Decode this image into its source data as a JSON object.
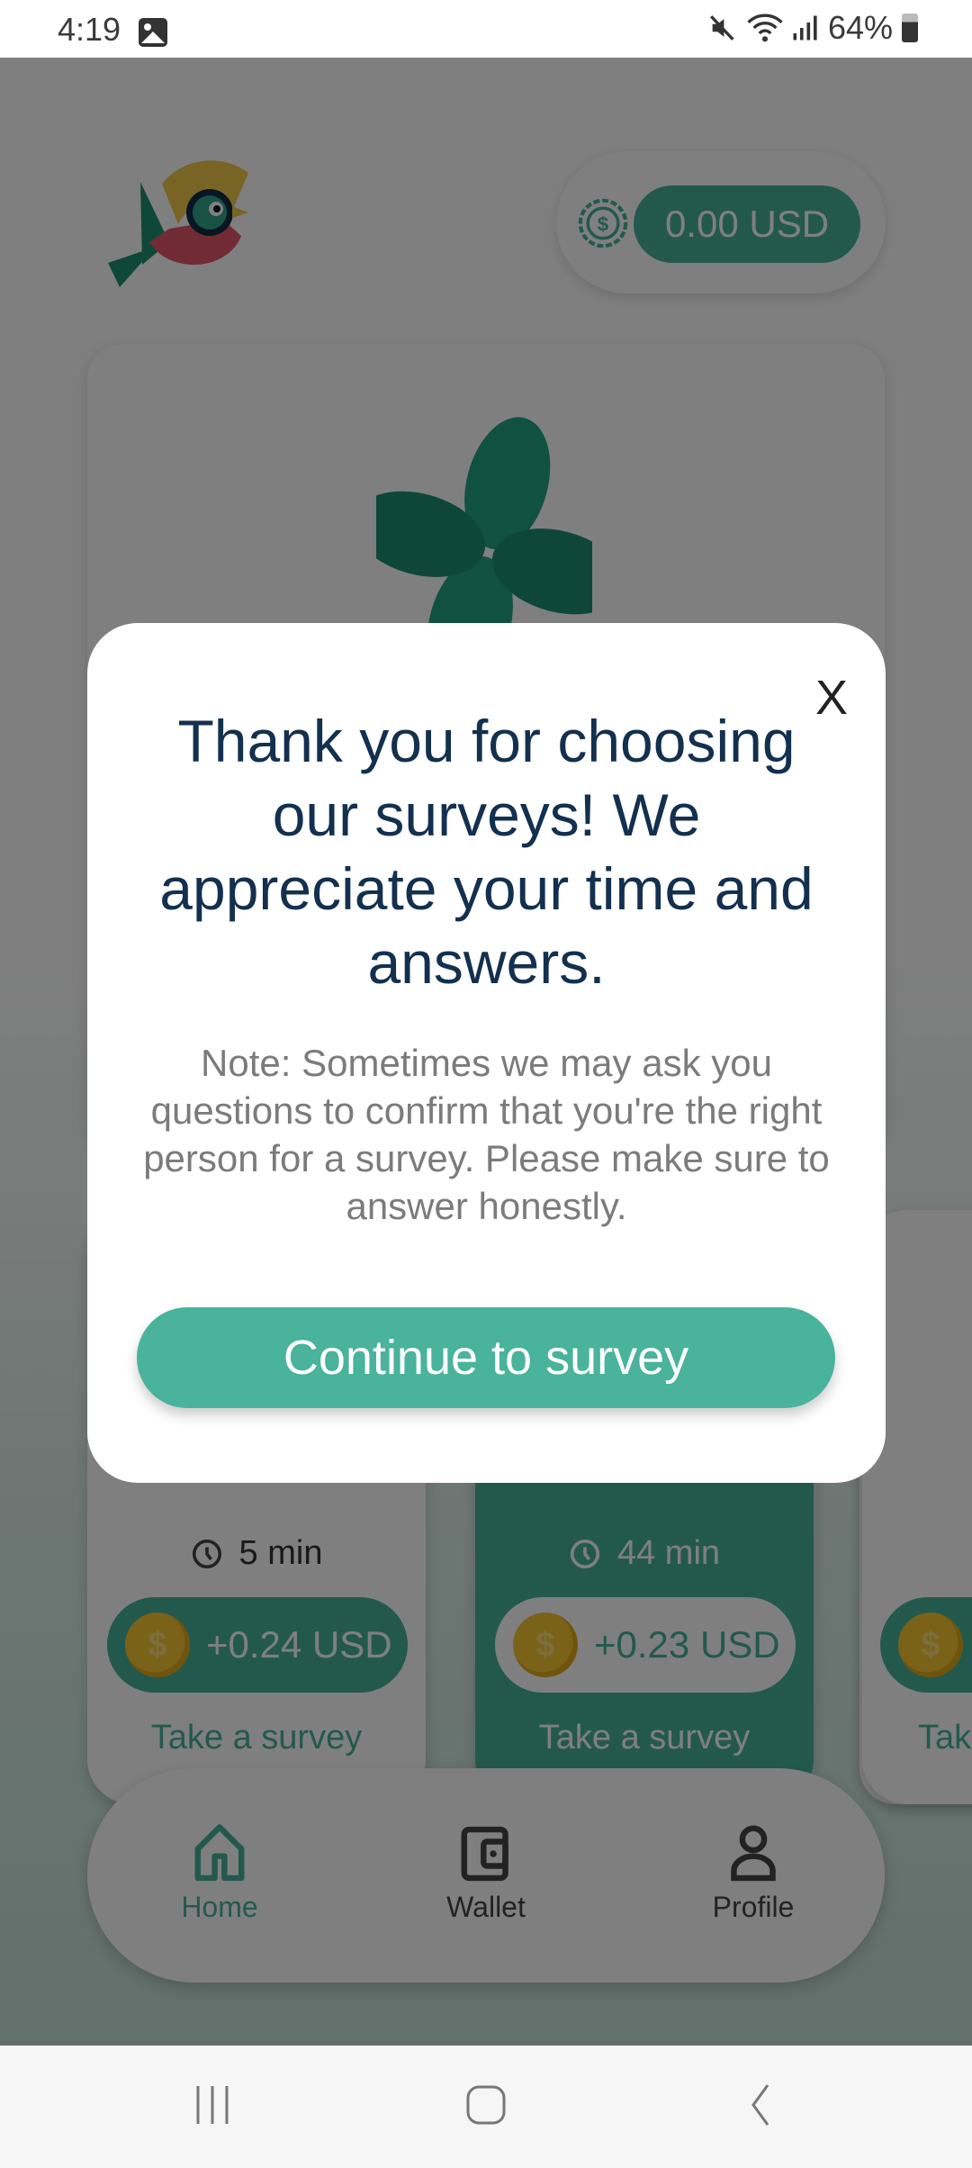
{
  "status_bar": {
    "time": "4:19",
    "battery": "64%",
    "icons": [
      "image-notification-icon",
      "mute-icon",
      "wifi-icon",
      "signal-icon",
      "battery-icon"
    ]
  },
  "header": {
    "logo": "bird-logo",
    "balance": "0.00 USD",
    "balance_icon": "dollar-coin-icon"
  },
  "hero": {
    "image": "four-leaf-clover"
  },
  "surveys": [
    {
      "duration": "5 min",
      "reward": "+0.24 USD",
      "cta": "Take a survey",
      "style": "light"
    },
    {
      "duration": "44 min",
      "reward": "+0.23 USD",
      "cta": "Take a survey",
      "style": "dark"
    },
    {
      "duration": "",
      "reward": "",
      "cta": "Tak",
      "style": "light"
    }
  ],
  "bottom_nav": {
    "items": [
      {
        "label": "Home",
        "icon": "home-icon",
        "active": true
      },
      {
        "label": "Wallet",
        "icon": "wallet-icon",
        "active": false
      },
      {
        "label": "Profile",
        "icon": "profile-icon",
        "active": false
      }
    ]
  },
  "modal": {
    "close_label": "X",
    "title": "Thank you for choosing our surveys! We appreciate your time and answers.",
    "note": "Note: Sometimes we may ask you questions to confirm that you're the right person for a survey. Please make sure to answer honestly.",
    "button_label": "Continue to survey"
  },
  "colors": {
    "accent": "#47b39b",
    "title": "#13304f",
    "note": "#7b7b7b",
    "coin": "#f4c431"
  }
}
